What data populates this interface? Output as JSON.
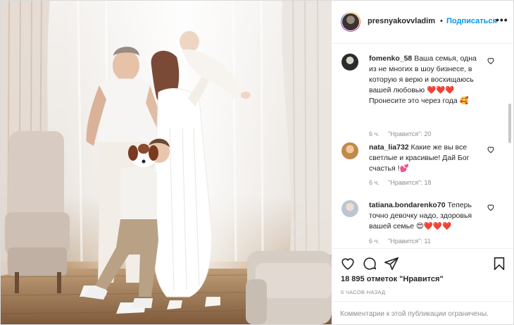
{
  "post": {
    "photo_description": "",
    "header": {
      "username": "presnyakovvladim",
      "separator": "•",
      "follow_label": "Подписаться",
      "more_label": "•••"
    },
    "comments": [
      {
        "username": "fomenko_58",
        "text": " Ваша семья, одна из не многих в шоу бизнесе, в которую я верю и восхищаюсь вашей любовью ❤️❤️❤️ Пронесите это через года 🥰",
        "time": "6 ч.",
        "likes": "\"Нравится\": 20"
      },
      {
        "username": "nata_lia732",
        "text": " Какие же вы все светлые и красивые! Дай Бог счастья !💕",
        "time": "6 ч.",
        "likes": "\"Нравится\": 18"
      },
      {
        "username": "tatiana.bondarenko70",
        "text": " Теперь точно девочку надо, здоровья вашей семье 😍❤️❤️❤️",
        "time": "6 ч.",
        "likes": "\"Нравится\": 11"
      }
    ],
    "likes_text": "18 895 отметок \"Нравится\"",
    "time_ago": "6 ЧАСОВ НАЗАД",
    "comments_disabled": "Комментарии к этой публикации ограничены."
  },
  "colors": {
    "accent": "#0095f6",
    "text": "#262626",
    "muted": "#8e8e8e",
    "border": "#dbdbdb"
  },
  "icons": [
    "more-icon",
    "heart-icon",
    "comment-icon",
    "share-icon",
    "bookmark-icon"
  ]
}
